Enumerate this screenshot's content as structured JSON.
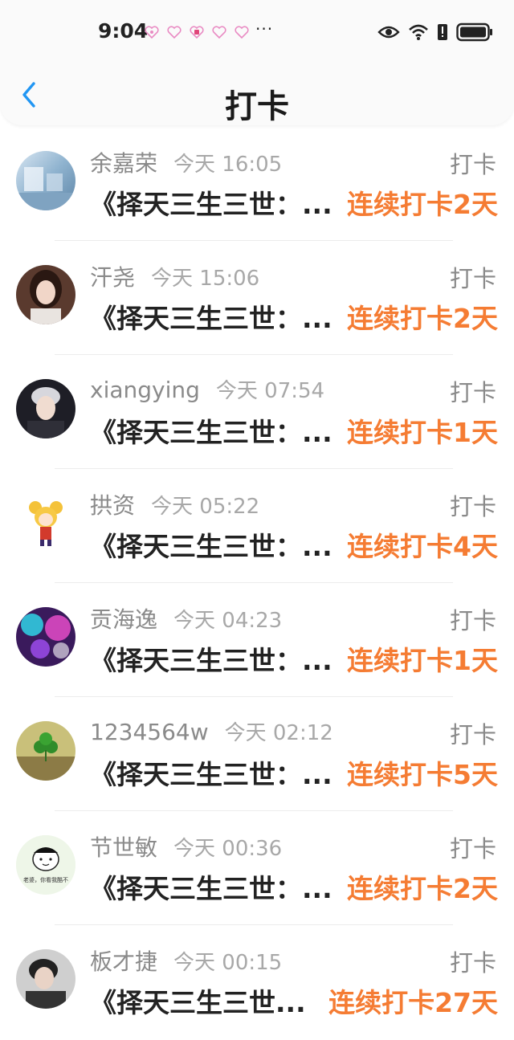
{
  "status_bar": {
    "time": "9:04",
    "more": "···",
    "notification_icons": [
      "heart-icon",
      "heart-icon",
      "badge-icon",
      "heart-icon",
      "heart-icon"
    ],
    "system_icons": [
      "eye-icon",
      "wifi-icon",
      "battery-alert-icon",
      "battery-icon"
    ]
  },
  "header": {
    "title": "打卡",
    "back_icon": "chevron-left-icon"
  },
  "colors": {
    "accent": "#2196f3",
    "streak": "#f57c33",
    "name": "#8a8a8a",
    "time": "#a8a8a8"
  },
  "items": [
    {
      "name": "余嘉荣",
      "time": "今天 16:05",
      "action": "打卡",
      "book": "《择天三生三世：...",
      "streak": "连续打卡2天",
      "avatar": "avatar-photo"
    },
    {
      "name": "汗尧",
      "time": "今天 15:06",
      "action": "打卡",
      "book": "《择天三生三世：...",
      "streak": "连续打卡2天",
      "avatar": "avatar-photo"
    },
    {
      "name": "xiangying",
      "time": "今天 07:54",
      "action": "打卡",
      "book": "《择天三生三世：...",
      "streak": "连续打卡1天",
      "avatar": "avatar-photo"
    },
    {
      "name": "拱资",
      "time": "今天 05:22",
      "action": "打卡",
      "book": "《择天三生三世：...",
      "streak": "连续打卡4天",
      "avatar": "avatar-cartoon"
    },
    {
      "name": "贡海逸",
      "time": "今天 04:23",
      "action": "打卡",
      "book": "《择天三生三世：...",
      "streak": "连续打卡1天",
      "avatar": "avatar-bokeh"
    },
    {
      "name": "1234564w",
      "time": "今天 02:12",
      "action": "打卡",
      "book": "《择天三生三世：...",
      "streak": "连续打卡5天",
      "avatar": "avatar-clover"
    },
    {
      "name": "节世敏",
      "time": "今天 00:36",
      "action": "打卡",
      "book": "《择天三生三世：...",
      "streak": "连续打卡2天",
      "avatar": "avatar-sticker",
      "avatar_caption": "老婆，你看我酷不"
    },
    {
      "name": "板才捷",
      "time": "今天 00:15",
      "action": "打卡",
      "book": "《择天三生三世...",
      "streak": "连续打卡27天",
      "avatar": "avatar-photo"
    }
  ]
}
